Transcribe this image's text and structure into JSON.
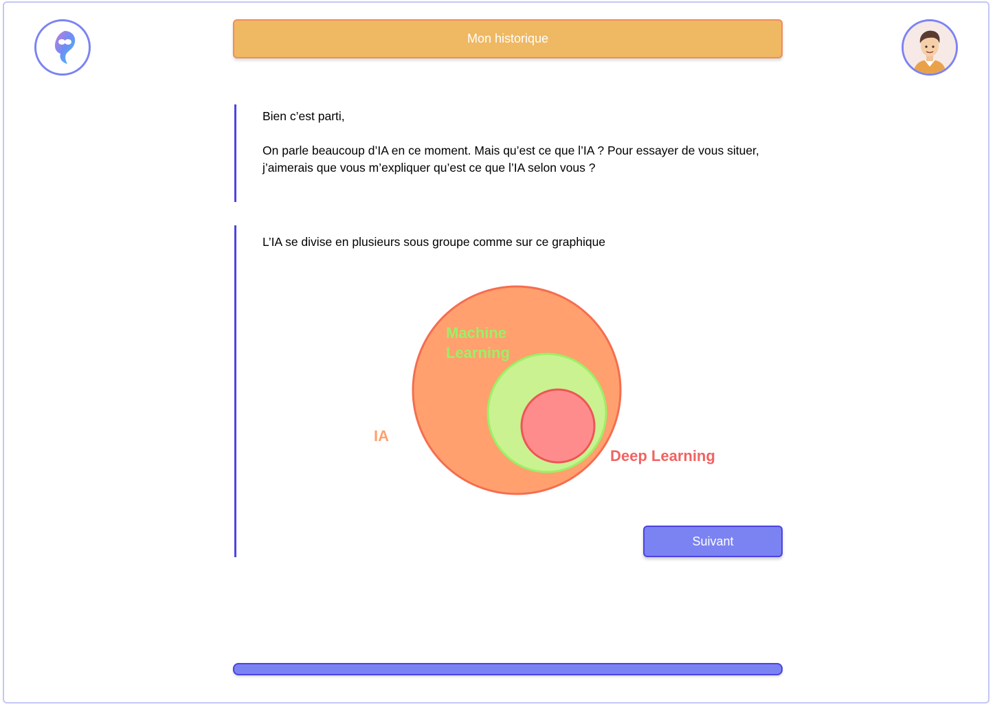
{
  "header": {
    "history_label": "Mon historique"
  },
  "icons": {
    "logo": "brain-logo-icon",
    "avatar": "user-avatar-icon"
  },
  "messages": [
    {
      "greeting": "Bien c’est parti,",
      "question": "On parle beaucoup d’IA en ce moment. Mais qu’est ce que l’IA ? Pour essayer de vous situer, j’aimerais que vous m’expliquer qu’est ce que l’IA selon vous ?"
    },
    {
      "intro": "L’IA se divise en plusieurs sous groupe comme sur ce graphique"
    }
  ],
  "diagram": {
    "sets": [
      {
        "label": "IA",
        "color": "#ffa06e",
        "border": "#f56d4f",
        "label_color": "#ffa06e"
      },
      {
        "label": "Machine Learning",
        "line1": "Machine",
        "line2": "Learning",
        "color": "#caf290",
        "border": "#9af066",
        "label_color": "#9af066"
      },
      {
        "label": "Deep Learning",
        "color": "#ff8c8c",
        "border": "#ec5656",
        "label_color": "#f26262"
      }
    ]
  },
  "actions": {
    "next_label": "Suivant"
  },
  "colors": {
    "accent": "#7b83f2",
    "accent_dark": "#4d43e0",
    "history_bg": "#efb862",
    "history_border": "#f28b5e"
  }
}
